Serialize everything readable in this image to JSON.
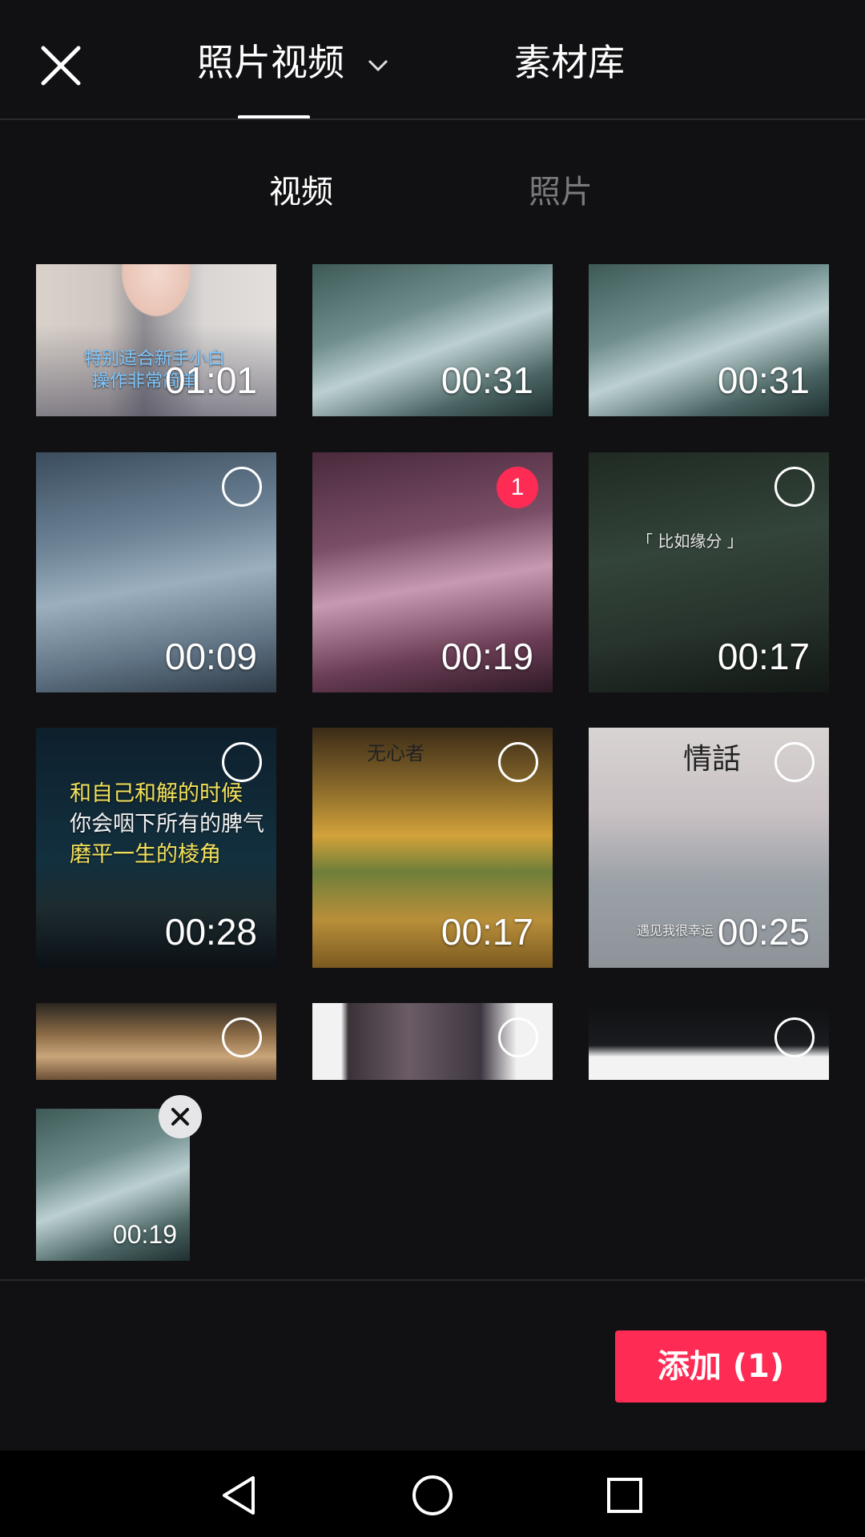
{
  "header": {
    "tabs": [
      {
        "label": "照片视频",
        "active": true
      },
      {
        "label": "素材库",
        "active": false
      }
    ],
    "close_icon": "close-icon",
    "dropdown_icon": "chevron-down-icon"
  },
  "subtabs": [
    {
      "label": "视频",
      "active": true
    },
    {
      "label": "照片",
      "active": false
    }
  ],
  "grid": [
    {
      "duration": "01:01",
      "selected": false,
      "caption_lines": [
        "特别适合新手小白",
        "操作非常简单"
      ]
    },
    {
      "duration": "00:31",
      "selected": false
    },
    {
      "duration": "00:31",
      "selected": false
    },
    {
      "duration": "00:09",
      "selected": false
    },
    {
      "duration": "00:19",
      "selected": true,
      "badge": "1"
    },
    {
      "duration": "00:17",
      "selected": false,
      "caption_lines": [
        "「 比如缘分 」"
      ]
    },
    {
      "duration": "00:28",
      "selected": false,
      "caption_lines": [
        "和自己和解的时候",
        "你会咽下所有的脾气",
        "磨平一生的棱角"
      ]
    },
    {
      "duration": "00:17",
      "selected": false,
      "caption_lines": [
        "无心者"
      ]
    },
    {
      "duration": "00:25",
      "selected": false,
      "caption_lines": [
        "情話",
        "遇见我很幸运"
      ]
    },
    {
      "duration": "",
      "selected": false
    },
    {
      "duration": "",
      "selected": false
    },
    {
      "duration": "",
      "selected": false
    }
  ],
  "tray": {
    "items": [
      {
        "duration": "00:19"
      }
    ]
  },
  "footer": {
    "add_label": "添加 (1)"
  },
  "colors": {
    "accent": "#fe2c55",
    "background": "#111113"
  }
}
